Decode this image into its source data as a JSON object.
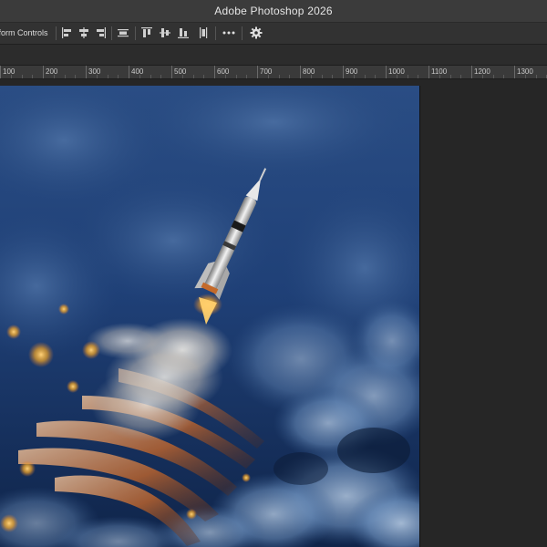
{
  "window": {
    "title": "Adobe Photoshop 2026"
  },
  "options_bar": {
    "transform_controls_label": "sform Controls",
    "icons": [
      "align-left-edges-icon",
      "align-horizontal-centers-icon",
      "align-right-edges-icon",
      "distribute-horizontal-icon",
      "align-top-edges-icon",
      "align-vertical-centers-icon",
      "align-bottom-edges-icon",
      "distribute-vertical-icon",
      "more-options-icon",
      "settings-gear-icon"
    ]
  },
  "ruler": {
    "labels": [
      "100",
      "200",
      "300",
      "400",
      "500",
      "600",
      "700",
      "800",
      "900",
      "1000",
      "1100",
      "1200",
      "1300"
    ]
  },
  "canvas": {
    "image_subject": "rocket-launch-clouds",
    "colors": {
      "sky": "#1e3f72",
      "cloud": "#8fb0d6",
      "fire": "#e07a2e",
      "glow": "#f5a623"
    }
  }
}
